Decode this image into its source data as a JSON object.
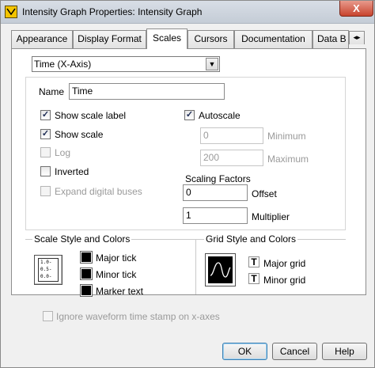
{
  "window": {
    "title": "Intensity Graph Properties: Intensity Graph",
    "close_label": "X"
  },
  "tabs": [
    "Appearance",
    "Display Format",
    "Scales",
    "Cursors",
    "Documentation",
    "Data B"
  ],
  "axis_select": {
    "value": "Time (X-Axis)"
  },
  "name": {
    "label": "Name",
    "value": "Time"
  },
  "options_left": [
    {
      "label": "Show scale label",
      "checked": true,
      "enabled": true
    },
    {
      "label": "Show scale",
      "checked": true,
      "enabled": true
    },
    {
      "label": "Log",
      "checked": false,
      "enabled": false
    },
    {
      "label": "Inverted",
      "checked": false,
      "enabled": true
    },
    {
      "label": "Expand digital buses",
      "checked": false,
      "enabled": false
    }
  ],
  "autoscale": {
    "label": "Autoscale",
    "checked": true
  },
  "minimum": {
    "label": "Minimum",
    "value": "0"
  },
  "maximum": {
    "label": "Maximum",
    "value": "200"
  },
  "scaling": {
    "title": "Scaling Factors",
    "offset_label": "Offset",
    "offset_value": "0",
    "multiplier_label": "Multiplier",
    "multiplier_value": "1"
  },
  "scale_style": {
    "title": "Scale Style and Colors",
    "preview": [
      "1.0-",
      "0.5-",
      "0.0-"
    ],
    "major_tick": "Major tick",
    "minor_tick": "Minor tick",
    "marker_text": "Marker text"
  },
  "grid_style": {
    "title": "Grid Style and Colors",
    "major_grid": "Major grid",
    "minor_grid": "Minor grid"
  },
  "ignore_waveform": {
    "label": "Ignore waveform time stamp on x-axes",
    "checked": false
  },
  "buttons": {
    "ok": "OK",
    "cancel": "Cancel",
    "help": "Help"
  },
  "colors": {
    "title_bar": "#c8d0da",
    "close_button": "#c8442e",
    "swatch": "#000000"
  }
}
